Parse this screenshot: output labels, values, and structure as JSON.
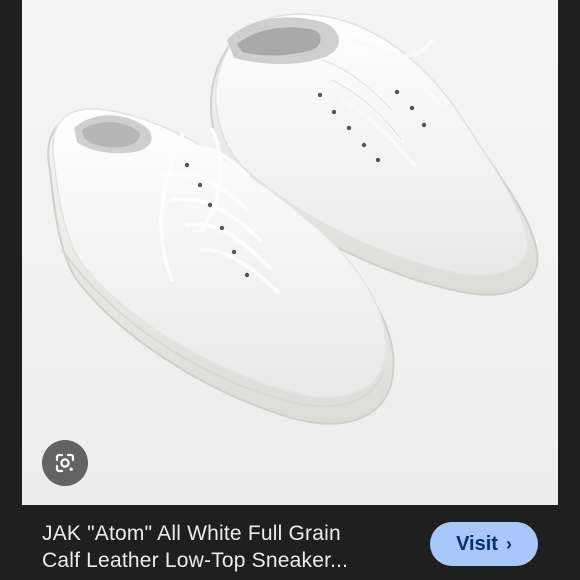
{
  "result": {
    "title_line1": "JAK \"Atom\" All White Full Grain",
    "title_line2": "Calf Leather Low-Top Sneaker...",
    "visit_label": "Visit",
    "visit_icon": "chevron-right-icon"
  },
  "lens": {
    "icon": "google-lens-icon"
  },
  "colors": {
    "background": "#1f1f1f",
    "visit_button": "#a8c7fa",
    "visit_text": "#062e6f",
    "caption_text": "#ececec"
  }
}
